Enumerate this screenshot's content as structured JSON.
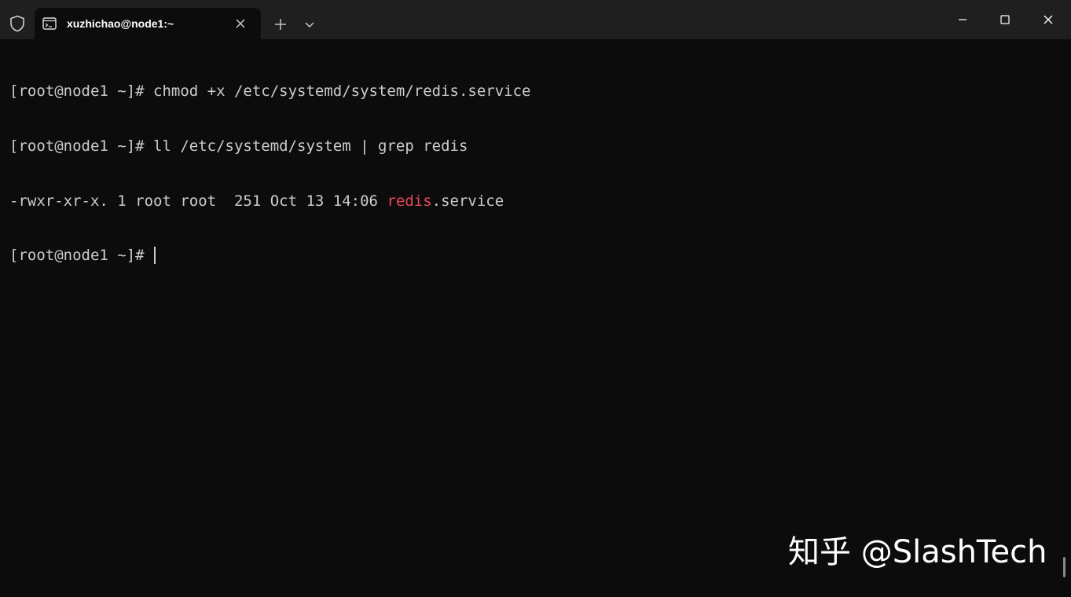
{
  "window": {
    "tab_title": "xuzhichao@node1:~"
  },
  "icons": {
    "shield": "shield-icon",
    "tab": "terminal-icon",
    "tab_close": "close-icon",
    "new_tab": "plus-icon",
    "dropdown": "chevron-down-icon",
    "minimize": "minimize-icon",
    "maximize": "maximize-icon",
    "close": "close-icon"
  },
  "colors": {
    "terminal_bg": "#0c0c0c",
    "titlebar_bg": "#1f1f1f",
    "text": "#cccccc",
    "highlight": "#e74856"
  },
  "terminal": {
    "line1": "[root@node1 ~]# chmod +x /etc/systemd/system/redis.service",
    "line2": "[root@node1 ~]# ll /etc/systemd/system | grep redis",
    "line3_prefix": "-rwxr-xr-x. 1 root root  251 Oct 13 14:06 ",
    "line3_match": "redis",
    "line3_suffix": ".service",
    "prompt": "[root@node1 ~]# "
  },
  "watermark": "知乎 @SlashTech"
}
